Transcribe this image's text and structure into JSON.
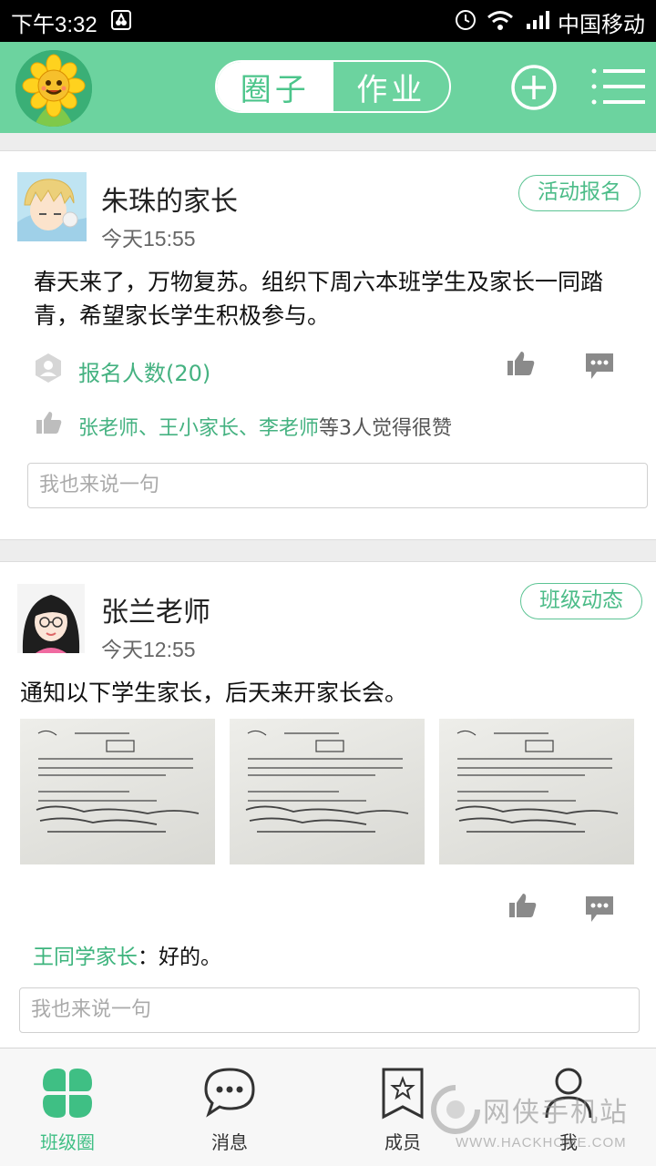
{
  "status_bar": {
    "time": "下午3:32",
    "carrier": "中国移动"
  },
  "header": {
    "tabs": [
      {
        "label": "圈子",
        "active": true
      },
      {
        "label": "作业",
        "active": false
      }
    ],
    "add_icon": "plus-circle-icon",
    "menu_icon": "menu-icon"
  },
  "posts": [
    {
      "author": "朱珠的家长",
      "time": "今天15:55",
      "badge": "活动报名",
      "content": "春天来了，万物复苏。组织下周六本班学生及家长一同踏青，希望家长学生积极参与。",
      "signup": "报名人数(20)",
      "likes_names": "张老师、王小家长、李老师",
      "likes_suffix": "等3人觉得很赞",
      "comment_placeholder": "我也来说一句"
    },
    {
      "author": "张兰老师",
      "time": "今天12:55",
      "badge": "班级动态",
      "content": "通知以下学生家长，后天来开家长会。",
      "reply_author": "王同学家长",
      "reply_text": "：好的。",
      "comment_placeholder": "我也来说一句"
    }
  ],
  "tabbar": [
    {
      "label": "班级圈",
      "icon": "clover-icon",
      "active": true
    },
    {
      "label": "消息",
      "icon": "chat-bubble-icon",
      "active": false
    },
    {
      "label": "成员",
      "icon": "star-book-icon",
      "active": false
    },
    {
      "label": "我",
      "icon": "user-icon",
      "active": false
    }
  ],
  "watermark": {
    "text": "网侠手机站",
    "url": "WWW.HACKHOME.COM"
  },
  "colors": {
    "accent": "#6cd39f",
    "link": "#45b281"
  }
}
